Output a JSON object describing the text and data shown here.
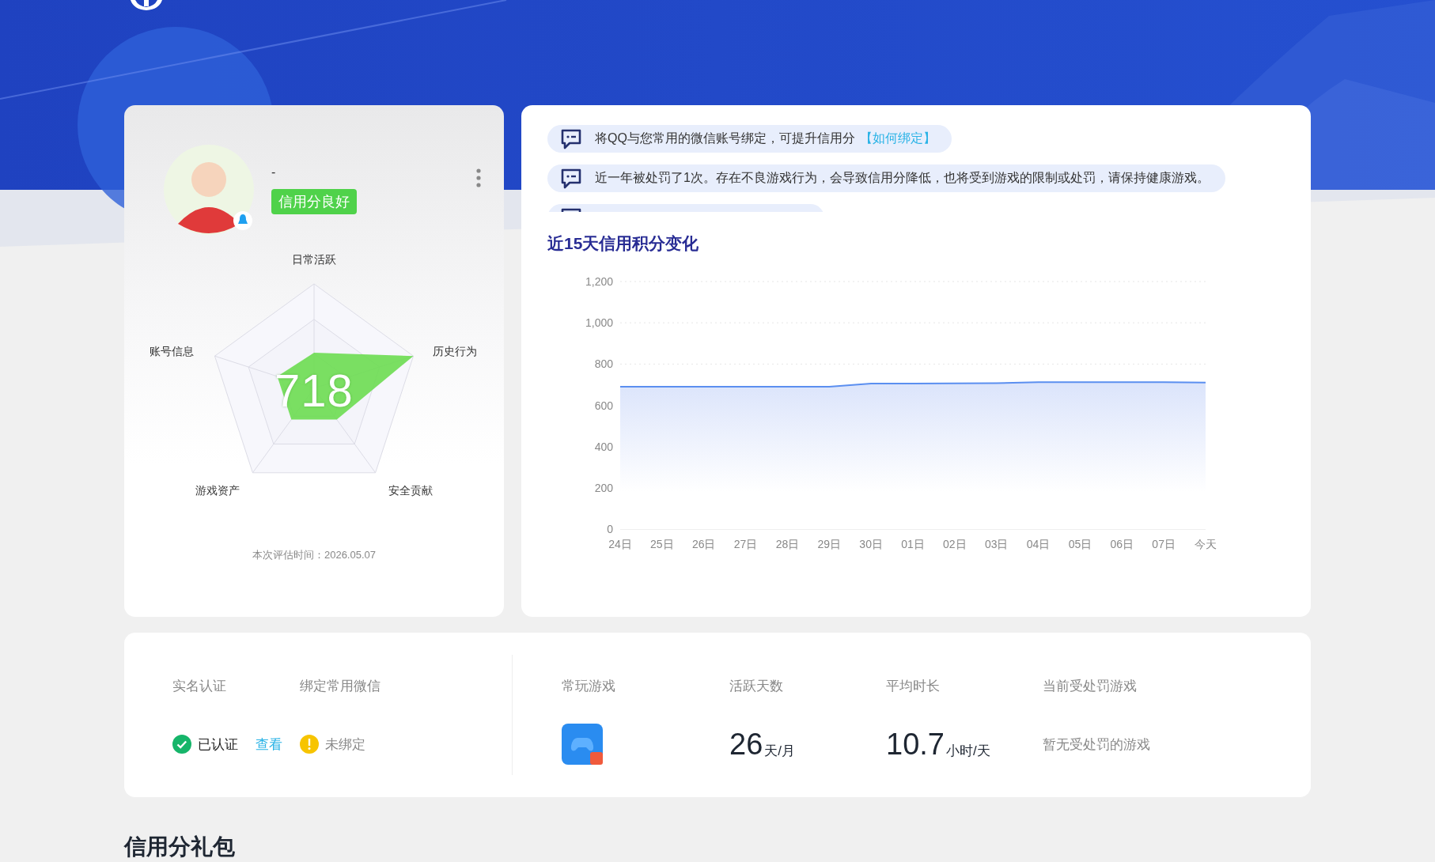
{
  "profile": {
    "name": "-",
    "badge": "信用分良好",
    "score": "718",
    "radar_labels": [
      "日常活跃",
      "历史行为",
      "安全贡献",
      "游戏资产",
      "账号信息"
    ],
    "evaluation_time": "本次评估时间：2026.05.07"
  },
  "notices": [
    {
      "text": "将QQ与您常用的微信账号绑定，可提升信用分",
      "link": "【如何绑定】"
    },
    {
      "text": "近一年被处罚了1次。存在不良游戏行为，会导致信用分降低，也将受到游戏的限制或处罚，请保持健康游戏。"
    }
  ],
  "chart": {
    "title": "近15天信用积分变化",
    "chart_data": {
      "type": "area",
      "categories": [
        "24日",
        "25日",
        "26日",
        "27日",
        "28日",
        "29日",
        "30日",
        "01日",
        "02日",
        "03日",
        "04日",
        "05日",
        "06日",
        "07日",
        "今天"
      ],
      "series": [
        {
          "color": "#5b8ff0",
          "values": [
            690,
            690,
            690,
            690,
            690,
            690,
            705,
            705,
            706,
            707,
            712,
            712,
            712,
            712,
            710
          ]
        }
      ],
      "ylim": [
        0,
        1200
      ],
      "yticks": [
        0,
        200,
        400,
        600,
        800,
        {
          "value": 1000,
          "label": "1,000"
        },
        {
          "value": 1200,
          "label": "1,200"
        }
      ]
    }
  },
  "stats": {
    "real_name": {
      "label": "实名认证",
      "status": "已认证",
      "ok": true,
      "link": "查看"
    },
    "wechat": {
      "label": "绑定常用微信",
      "status": "未绑定",
      "ok": false
    },
    "games": {
      "label": "常玩游戏"
    },
    "active_days": {
      "label": "活跃天数",
      "value": "26",
      "unit": "天/月"
    },
    "avg_time": {
      "label": "平均时长",
      "value": "10.7",
      "unit": "小时/天"
    },
    "penalty": {
      "label": "当前受处罚游戏",
      "value": "暂无受处罚的游戏"
    }
  },
  "section_title": "信用分礼包"
}
